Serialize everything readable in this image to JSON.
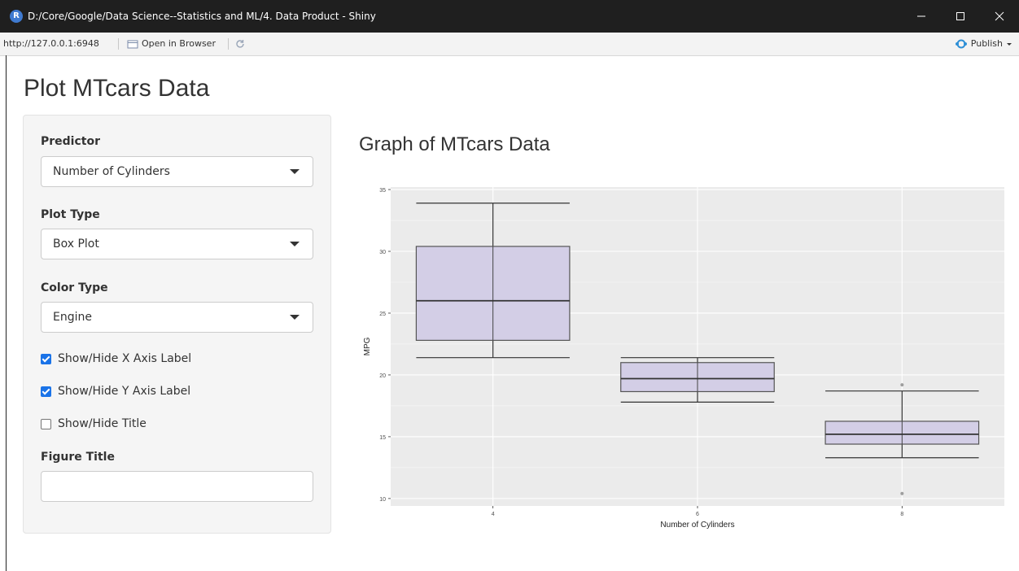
{
  "window": {
    "title": "D:/Core/Google/Data Science--Statistics and ML/4. Data Product - Shiny",
    "app_icon": "R",
    "controls": [
      "minimize-icon",
      "maximize-icon",
      "close-icon"
    ]
  },
  "address_bar": {
    "url": "http://127.0.0.1:6948",
    "open_in_browser": "Open in Browser",
    "publish": "Publish"
  },
  "page": {
    "title": "Plot MTcars Data",
    "graph_title": "Graph of MTcars Data"
  },
  "sidebar": {
    "predictor": {
      "label": "Predictor",
      "value": "Number of Cylinders"
    },
    "plot_type": {
      "label": "Plot Type",
      "value": "Box Plot"
    },
    "color_type": {
      "label": "Color Type",
      "value": "Engine"
    },
    "checkboxes": [
      {
        "label": "Show/Hide X Axis Label",
        "checked": true
      },
      {
        "label": "Show/Hide Y Axis Label",
        "checked": true
      },
      {
        "label": "Show/Hide Title",
        "checked": false
      }
    ],
    "figure_title": {
      "label": "Figure Title",
      "value": ""
    }
  },
  "colors": {
    "accent": "#1a73e8",
    "plot_panel": "#ebebeb",
    "box_fill": "#d3cee6"
  },
  "chart_data": {
    "type": "box",
    "title": "",
    "xlabel": "Number of Cylinders",
    "ylabel": "MPG",
    "categories": [
      "4",
      "6",
      "8"
    ],
    "ylim": [
      9.4,
      35.2
    ],
    "yticks": [
      10,
      15,
      20,
      25,
      30,
      35
    ],
    "boxes": [
      {
        "category": "4",
        "whisker_low": 21.4,
        "q1": 22.8,
        "median": 26.0,
        "q3": 30.4,
        "whisker_high": 33.9,
        "outliers": []
      },
      {
        "category": "6",
        "whisker_low": 17.8,
        "q1": 18.65,
        "median": 19.7,
        "q3": 21.0,
        "whisker_high": 21.4,
        "outliers": []
      },
      {
        "category": "8",
        "whisker_low": 13.3,
        "q1": 14.4,
        "median": 15.2,
        "q3": 16.25,
        "whisker_high": 18.7,
        "outliers": [
          10.4,
          19.2
        ]
      }
    ],
    "grid": true,
    "legend": "none"
  }
}
